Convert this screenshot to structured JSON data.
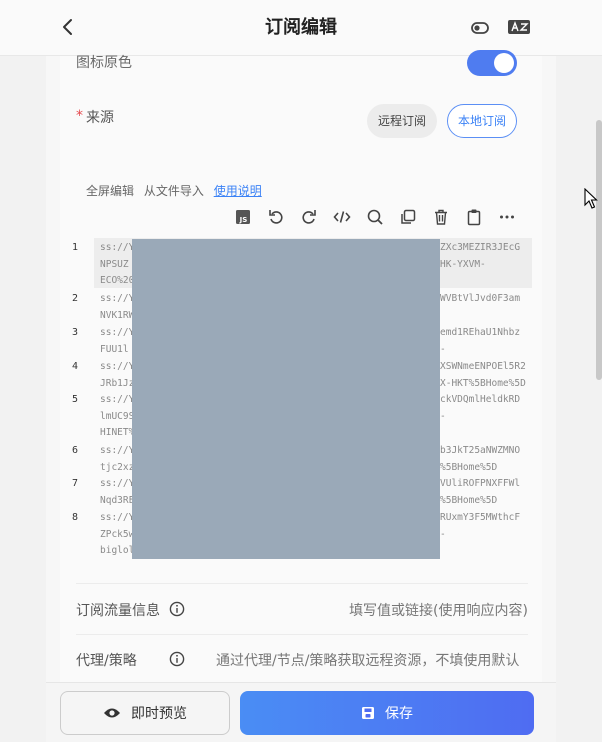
{
  "header": {
    "title": "订阅编辑",
    "back_icon": "chevron-left-icon",
    "toggle_icon": "toggle-icon",
    "translate_icon": "translate-icon"
  },
  "form": {
    "icon_color_label": "图标原色",
    "icon_color_enabled": true,
    "source": {
      "required_mark": "*",
      "label": "来源",
      "options": [
        "远程订阅",
        "本地订阅"
      ],
      "selected": "本地订阅"
    },
    "editor": {
      "links": {
        "fullscreen": "全屏编辑",
        "import": "从文件导入",
        "help": "使用说明"
      },
      "toolbar_icons": [
        "js-icon",
        "undo-icon",
        "redo-icon",
        "code-icon",
        "search-icon",
        "copy-icon",
        "delete-icon",
        "paste-icon",
        "more-icon"
      ],
      "lines": [
        {
          "num": "1",
          "left": [
            "ss://Y",
            "NPSUZ",
            "ECO%20"
          ],
          "right": [
            "ZXc3MEZIR3JEcG",
            "HK-YXVM-",
            ""
          ]
        },
        {
          "num": "2",
          "left": [
            "ss://Y",
            "NVK1RW"
          ],
          "right": [
            "WVBtVlJvd0F3am",
            ""
          ]
        },
        {
          "num": "3",
          "left": [
            "ss://Y",
            "FUU1l"
          ],
          "right": [
            "emd1REhaU1Nhbz",
            "-"
          ]
        },
        {
          "num": "4",
          "left": [
            "ss://Y",
            "JRb1Jz"
          ],
          "right": [
            "XSWNmeENPOEl5R2",
            "X-HKT%5BHome%5D"
          ]
        },
        {
          "num": "5",
          "left": [
            "ss://Y",
            "lmUC9S",
            "HINET%"
          ],
          "right": [
            "ckVDQmlHeldkRD",
            "-",
            ""
          ]
        },
        {
          "num": "6",
          "left": [
            "ss://Y",
            "tjc2xz"
          ],
          "right": [
            "b3JkT25aNWZMNO",
            "%5BHome%5D"
          ]
        },
        {
          "num": "7",
          "left": [
            "ss://Y",
            "Nqd3RE"
          ],
          "right": [
            "VUliROFPNXFFWl",
            "%5BHome%5D"
          ]
        },
        {
          "num": "8",
          "left": [
            "ss://Y",
            "ZPck5w",
            "biglol"
          ],
          "right": [
            "RUxmY3F5MWthcF",
            "-",
            ""
          ]
        }
      ]
    },
    "traffic_info": {
      "label": "订阅流量信息",
      "placeholder": "填写值或链接(使用响应内容)"
    },
    "proxy": {
      "label": "代理/策略",
      "placeholder": "通过代理/节点/策略获取远程资源，不填使用默认"
    }
  },
  "bottom": {
    "preview_label": "即时预览",
    "save_label": "保存"
  },
  "colors": {
    "accent": "#4f7cf0",
    "danger": "#e5484d",
    "redaction": "#9aa9b8"
  }
}
